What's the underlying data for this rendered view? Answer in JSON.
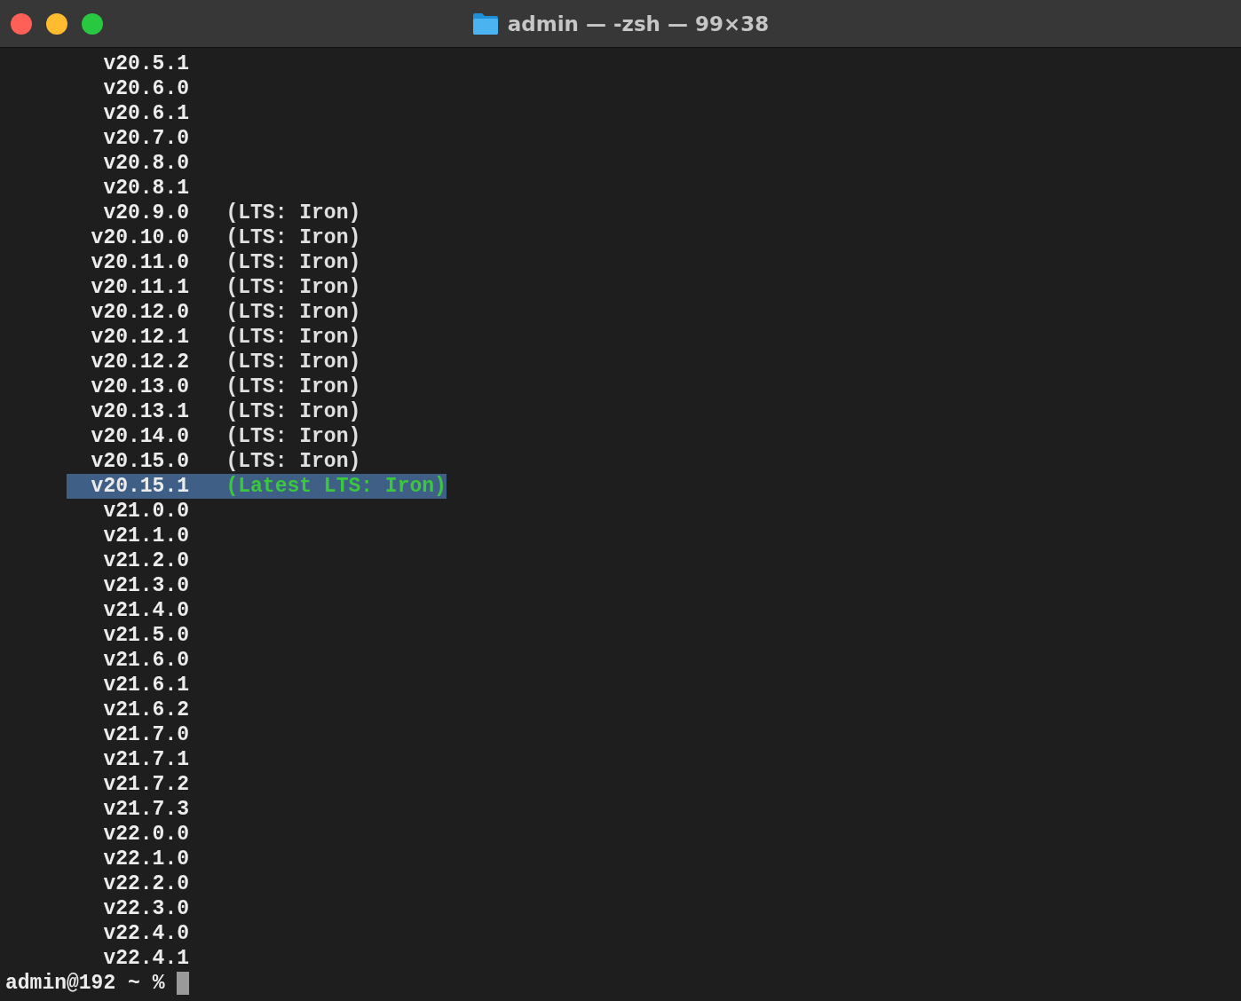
{
  "window": {
    "title": "admin — -zsh — 99×38"
  },
  "rows": [
    {
      "version": "v20.5.1",
      "selected": false
    },
    {
      "version": "v20.6.0",
      "selected": false
    },
    {
      "version": "v20.6.1",
      "selected": false
    },
    {
      "version": "v20.7.0",
      "selected": false
    },
    {
      "version": "v20.8.0",
      "selected": false
    },
    {
      "version": "v20.8.1",
      "selected": false
    },
    {
      "version": "v20.9.0",
      "label": "(LTS: Iron)",
      "selected": false
    },
    {
      "version": "v20.10.0",
      "label": "(LTS: Iron)",
      "selected": false
    },
    {
      "version": "v20.11.0",
      "label": "(LTS: Iron)",
      "selected": false
    },
    {
      "version": "v20.11.1",
      "label": "(LTS: Iron)",
      "selected": false
    },
    {
      "version": "v20.12.0",
      "label": "(LTS: Iron)",
      "selected": false
    },
    {
      "version": "v20.12.1",
      "label": "(LTS: Iron)",
      "selected": false
    },
    {
      "version": "v20.12.2",
      "label": "(LTS: Iron)",
      "selected": false
    },
    {
      "version": "v20.13.0",
      "label": "(LTS: Iron)",
      "selected": false
    },
    {
      "version": "v20.13.1",
      "label": "(LTS: Iron)",
      "selected": false
    },
    {
      "version": "v20.14.0",
      "label": "(LTS: Iron)",
      "selected": false
    },
    {
      "version": "v20.15.0",
      "label": "(LTS: Iron)",
      "selected": false
    },
    {
      "version": "v20.15.1",
      "label": "(Latest LTS: Iron)",
      "selected": true
    },
    {
      "version": "v21.0.0",
      "selected": false
    },
    {
      "version": "v21.1.0",
      "selected": false
    },
    {
      "version": "v21.2.0",
      "selected": false
    },
    {
      "version": "v21.3.0",
      "selected": false
    },
    {
      "version": "v21.4.0",
      "selected": false
    },
    {
      "version": "v21.5.0",
      "selected": false
    },
    {
      "version": "v21.6.0",
      "selected": false
    },
    {
      "version": "v21.6.1",
      "selected": false
    },
    {
      "version": "v21.6.2",
      "selected": false
    },
    {
      "version": "v21.7.0",
      "selected": false
    },
    {
      "version": "v21.7.1",
      "selected": false
    },
    {
      "version": "v21.7.2",
      "selected": false
    },
    {
      "version": "v21.7.3",
      "selected": false
    },
    {
      "version": "v22.0.0",
      "selected": false
    },
    {
      "version": "v22.1.0",
      "selected": false
    },
    {
      "version": "v22.2.0",
      "selected": false
    },
    {
      "version": "v22.3.0",
      "selected": false
    },
    {
      "version": "v22.4.0",
      "selected": false
    },
    {
      "version": "v22.4.1",
      "selected": false
    }
  ],
  "prompt": "admin@192 ~ %"
}
